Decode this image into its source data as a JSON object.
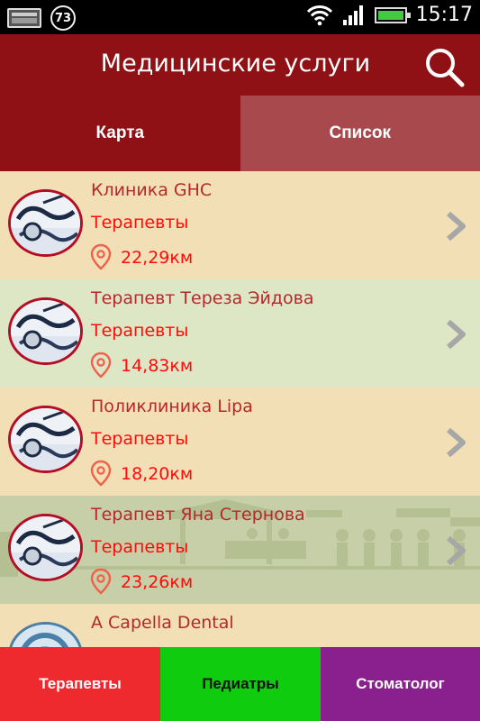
{
  "status_bar": {
    "notification_count": "73",
    "time": "15:17",
    "icons": [
      "image-icon",
      "notification-badge",
      "wifi-icon",
      "signal-icon",
      "battery-icon"
    ]
  },
  "app_bar": {
    "title": "Медицинские услуги",
    "search_icon": "search-icon"
  },
  "tabs": [
    {
      "label": "Карта",
      "active": false
    },
    {
      "label": "Список",
      "active": true
    }
  ],
  "list": {
    "items": [
      {
        "name": "Клиника GHC",
        "category": "Терапевты",
        "distance": "22,29км"
      },
      {
        "name": "Терапевт Тереза Эйдова",
        "category": "Терапевты",
        "distance": "14,83км"
      },
      {
        "name": "Поликлиника Lipa",
        "category": "Терапевты",
        "distance": "18,20км"
      },
      {
        "name": "Терапевт Яна Стернова",
        "category": "Терапевты",
        "distance": "23,26км"
      },
      {
        "name": "A Capella Dental",
        "category": "",
        "distance": ""
      }
    ]
  },
  "bottom_nav": {
    "therapists": "Терапевты",
    "pediatricians": "Педиатры",
    "dentist": "Стоматолог"
  },
  "colors": {
    "primary": "#8f1115",
    "tab_active": "#a84a4d",
    "red_text": "#ff0b0b",
    "name_text": "#b7282d",
    "therapists_button": "#ee2a2f",
    "pediatricians_button": "#0fcc0f",
    "dentist_button": "#8a1f8e"
  }
}
